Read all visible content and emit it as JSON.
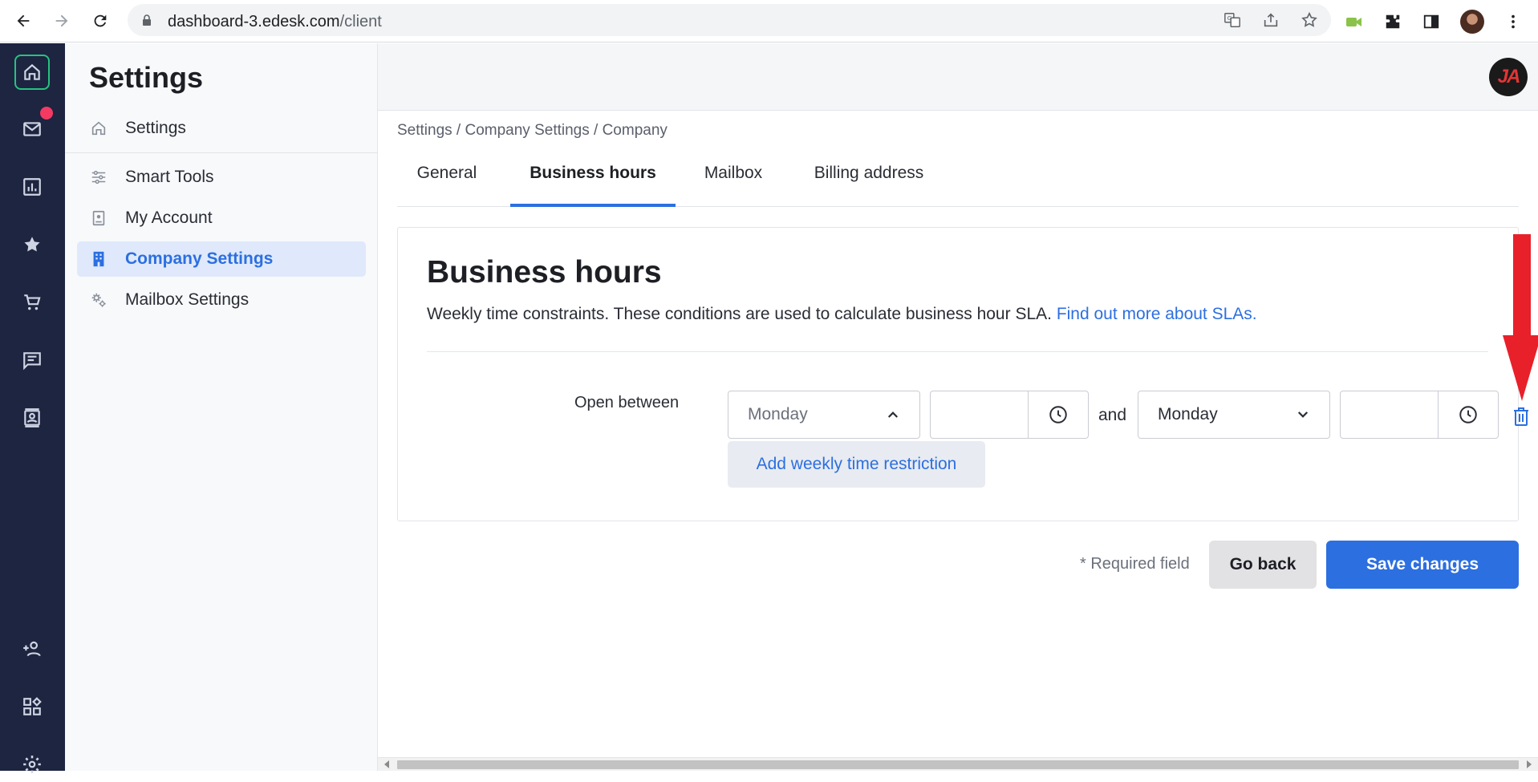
{
  "browser": {
    "url_host": "dashboard-3.edesk.com",
    "url_path": "/client"
  },
  "rail": {
    "items": [
      "home-icon",
      "mail-icon",
      "analytics-icon",
      "star-icon",
      "cart-icon",
      "chat-icon",
      "contacts-icon",
      "add-user-icon",
      "apps-icon",
      "gear-icon"
    ]
  },
  "sidebar": {
    "title": "Settings",
    "items": [
      {
        "label": "Settings",
        "icon": "home-icon"
      },
      {
        "label": "Smart Tools",
        "icon": "sliders-icon"
      },
      {
        "label": "My Account",
        "icon": "account-icon"
      },
      {
        "label": "Company Settings",
        "icon": "building-icon",
        "active": true
      },
      {
        "label": "Mailbox Settings",
        "icon": "gears-icon"
      }
    ]
  },
  "header": {
    "avatar_initials": "JA"
  },
  "breadcrumb": "Settings / Company Settings / Company",
  "tabs": [
    {
      "label": "General"
    },
    {
      "label": "Business hours",
      "active": true
    },
    {
      "label": "Mailbox"
    },
    {
      "label": "Billing address"
    }
  ],
  "card": {
    "title": "Business hours",
    "description": "Weekly time constraints. These conditions are used to calculate business hour SLA.",
    "link": "Find out more about SLAs.",
    "open_between_label": "Open between",
    "from_day": "Monday",
    "from_time": "",
    "and_label": "and",
    "to_day": "Monday",
    "to_time": "",
    "add_restriction": "Add weekly time restriction"
  },
  "footer": {
    "required_note": "* Required field",
    "go_back": "Go back",
    "save": "Save changes"
  },
  "colors": {
    "rail_bg": "#1d2540",
    "accent": "#2c6fe0",
    "annotation_arrow": "#e8202a"
  }
}
